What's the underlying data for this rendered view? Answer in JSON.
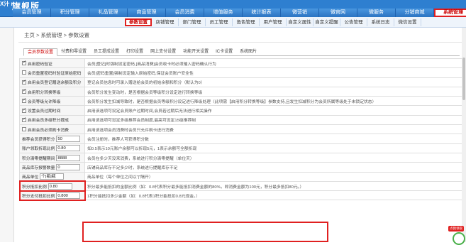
{
  "brand": {
    "logo_text": "X汁\nn",
    "title": "旗舰版"
  },
  "main_nav": [
    "会员管理",
    "积分管理",
    "礼品管理",
    "商品管理",
    "会员消费",
    "增值服务",
    "统计报表",
    "微营销",
    "微官网",
    "微服务",
    "分销商城",
    "系统管理"
  ],
  "main_nav_active": "系统管理",
  "sub_nav": [
    "参数设置",
    "店铺管理",
    "部门管理",
    "员工管理",
    "角色管理",
    "用户管理",
    "自定义属性",
    "自定义提醒",
    "公告管理",
    "系统日志",
    "微信设置"
  ],
  "sub_nav_active": "参数设置",
  "breadcrumb": "主页 > 系统管理 > 参数设置",
  "tabs": [
    "会员参数设置",
    "付费和零设置",
    "员工提成设置",
    "打印设置",
    "网上支付设置",
    "功能开关设置",
    "IC卡设置",
    "系统图片"
  ],
  "tabs_active": "会员参数设置",
  "rows": [
    {
      "label": "启用密码验证",
      "checkbox": true,
      "checked": true,
      "desc": "会员[登记]时强制设定密码,[商品消费]会员收卡时必须输入密码确认行为"
    },
    {
      "label": "会员重置密码时验证原始密码",
      "checkbox": true,
      "checked": false,
      "desc": "会员[密码重置]强制设定输入原始密码,保证会员账户安全性"
    },
    {
      "label": "启用会员登记赠送余额及积分",
      "checkbox": true,
      "checked": true,
      "desc": "登记会员信息时可录入赠送给会员的初始余额和积分（默认为0）"
    },
    {
      "label": "启用积分转换等级",
      "checkbox": true,
      "checked": true,
      "desc": "会员积分发生变动时，是否根据会员等级积分设定进行转换等级"
    },
    {
      "label": "会员等级允许降级",
      "checkbox": true,
      "checked": true,
      "desc": "会员积分发生扣减导致时，是否根据会员等级积分设定进行降级处理（此项需【启用积分转换等级】参数支持,且发生扣减积分为会员所属等级处于未锁定状态）"
    },
    {
      "label": "设置会员过期时间",
      "checkbox": true,
      "checked": true,
      "desc": "启用该选项可设定会员账户过期时间,会员若过期后无法进行相关操作"
    },
    {
      "label": "启用会员多级积分提成",
      "checkbox": true,
      "checked": true,
      "desc": "启用该选项可设定多级推荐会员制度,最高可设定15级推荐制"
    },
    {
      "label": "启用会员必须刷卡消费",
      "checkbox": true,
      "checked": false,
      "desc": "启用该选项会员消费时会员只允许刷卡进行消费"
    },
    {
      "label": "推荐会员获得积分",
      "input": "50",
      "desc": "会员注册时，推荐人可获得积分数"
    },
    {
      "label": "账户领取折现比例",
      "input": "0.80",
      "desc": "如0.5表示10元账户余额可以折现5元，1表示余额可全额折现"
    },
    {
      "label": "积分清零提醒期间",
      "input": "8888",
      "desc": "会员在多少天没来消费，系统进行积分清零提醒（单位天）"
    },
    {
      "label": "商品库存报警数量",
      "input": "0",
      "desc": "店铺商品库存不足多少时，系统进行提醒库存不足"
    },
    {
      "label": "商品单位",
      "input": "个|瓶|瓶",
      "desc": "商品单位（每个单位之间以\"|\"隔开）"
    },
    {
      "label": "积分抵扣比例",
      "input": "0.80",
      "highlight": true,
      "desc": "积分最多能抵扣的金额比例（如：0.8代表积分最多能抵扣消费金额的80%，即消费金额为100元，积分最多抵扣80元。）"
    },
    {
      "label": "积分支付抵扣比例",
      "input": "0.800",
      "highlight": true,
      "desc": "1积分能抵扣多少金额（如：0.8代表1积分能抵扣0.8元现金。）"
    }
  ],
  "float_badge": "点我领取",
  "colors": {
    "nav_blue": "#2e7fd0",
    "highlight_red": "#e02020"
  }
}
